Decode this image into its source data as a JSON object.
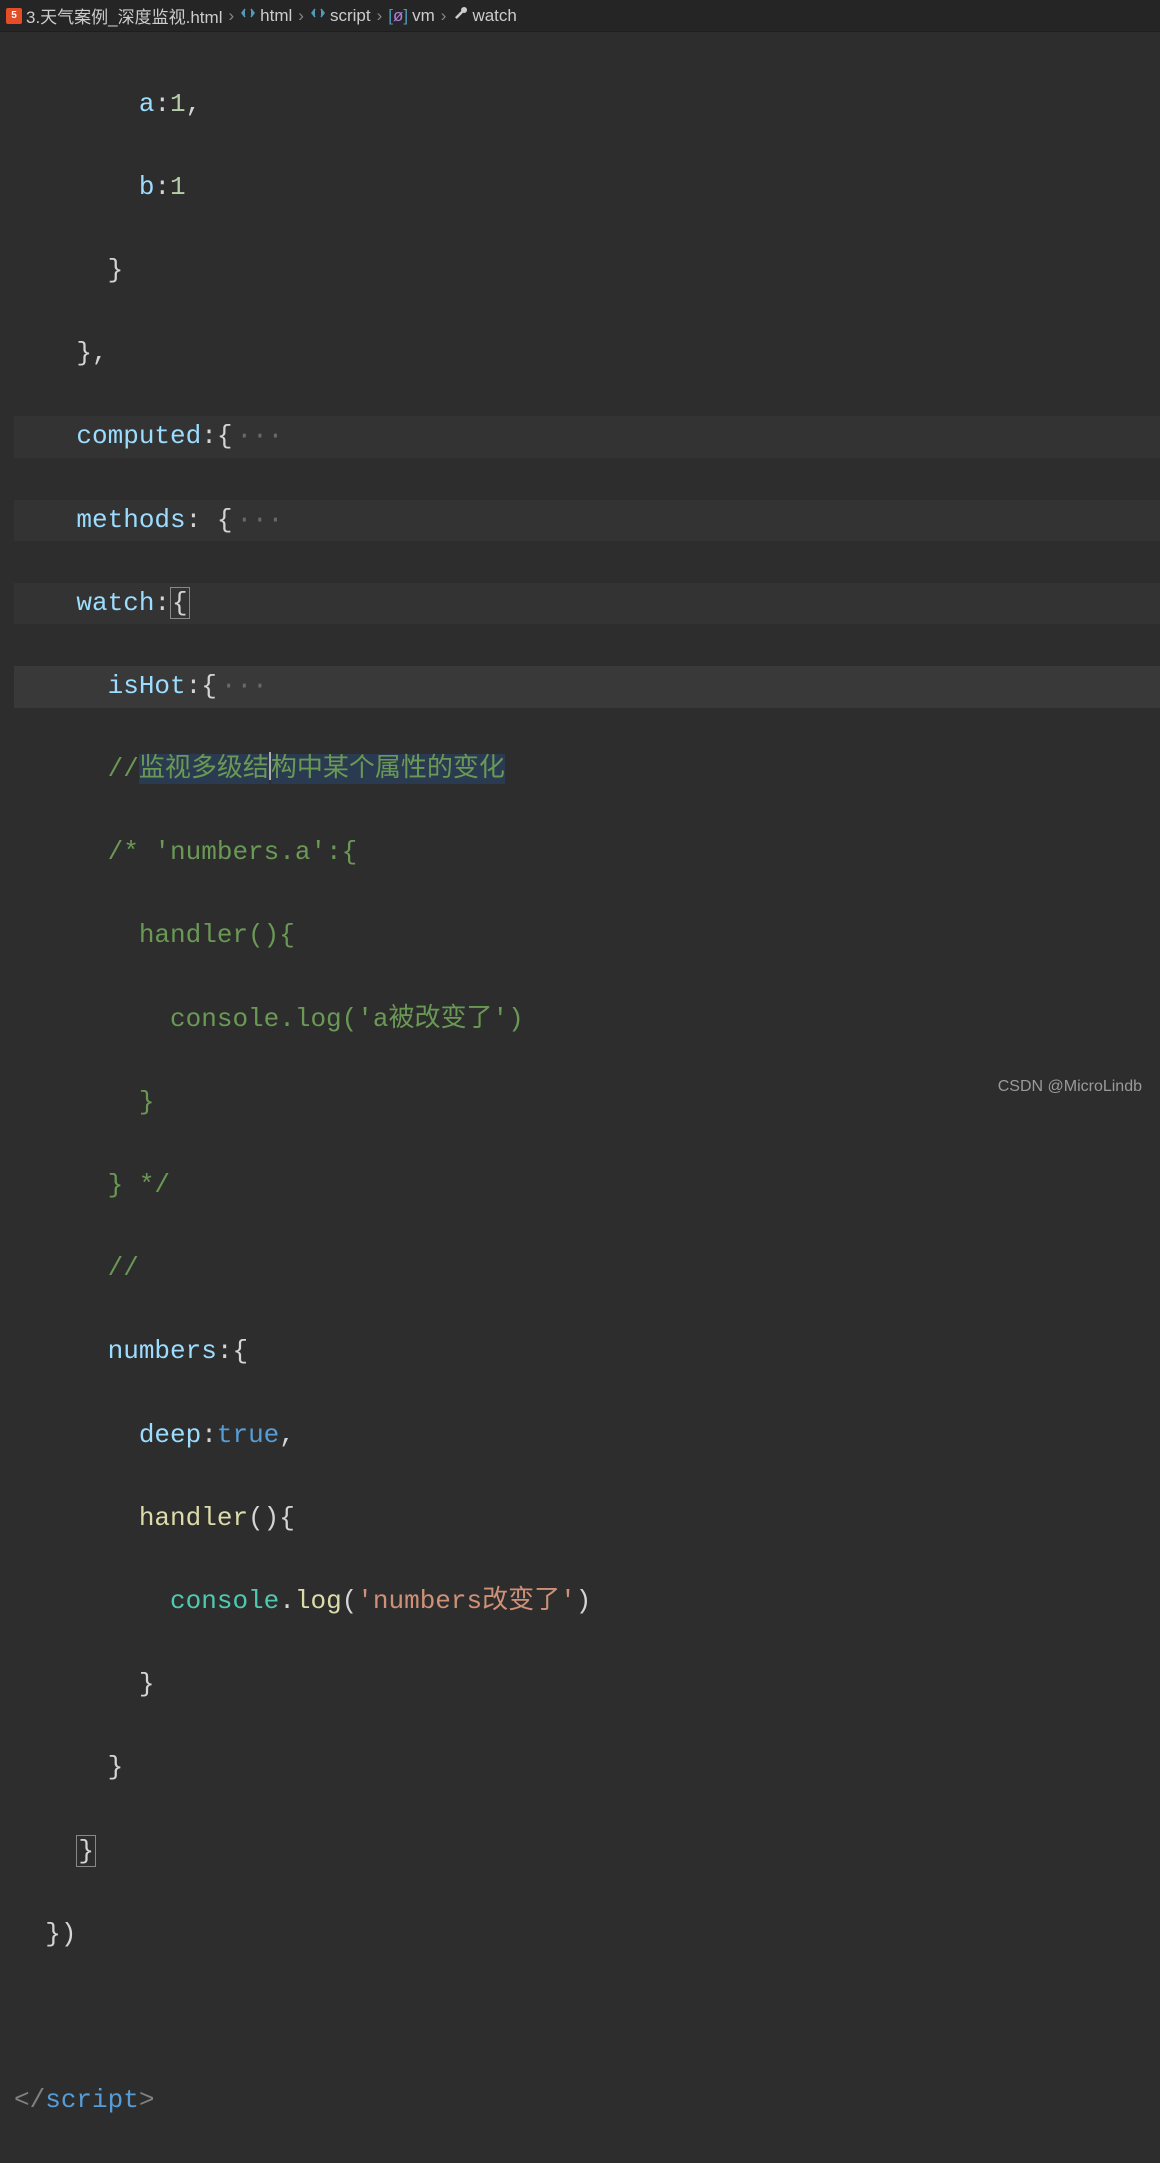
{
  "breadcrumb": {
    "file": "3.天气案例_深度监视.html",
    "path": [
      "html",
      "script",
      "vm",
      "watch"
    ]
  },
  "code": {
    "l1_ind": "        ",
    "l1_prop": "a",
    "l1_rest": ":",
    "l1_num": "1",
    "l1_end": ",",
    "l2_ind": "        ",
    "l2_prop": "b",
    "l2_rest": ":",
    "l2_num": "1",
    "l3_ind": "      ",
    "l3_txt": "}",
    "l4_ind": "    ",
    "l4_txt": "},",
    "l5_ind": "    ",
    "l5_prop": "computed",
    "l5_rest": ":{",
    "l5_fold": "···",
    "l6_ind": "    ",
    "l6_prop": "methods",
    "l6_rest": ": {",
    "l6_fold": "···",
    "l7_ind": "    ",
    "l7_prop": "watch",
    "l7_rest": ":",
    "l7_brace": "{",
    "l8_ind": "      ",
    "l8_prop": "isHot",
    "l8_rest": ":{",
    "l8_fold": "···",
    "l9_ind": "      ",
    "l9_c1": "//",
    "l9_c2": "监视多级结",
    "l9_c3": "构中某个属性的变化",
    "l10_ind": "      ",
    "l10_txt": "/* 'numbers.a':{",
    "l11_ind": "        ",
    "l11_txt": "handler(){",
    "l12_ind": "          ",
    "l12_txt": "console.log('a被改变了')",
    "l13_ind": "        ",
    "l13_txt": "}",
    "l14_ind": "      ",
    "l14_txt": "} */",
    "l15_ind": "      ",
    "l15_txt": "//",
    "l16_ind": "      ",
    "l16_prop": "numbers",
    "l16_rest": ":{",
    "l17_ind": "        ",
    "l17_prop": "deep",
    "l17_rest": ":",
    "l17_kw": "true",
    "l17_end": ",",
    "l18_ind": "        ",
    "l18_func": "handler",
    "l18_rest": "(){",
    "l19_ind": "          ",
    "l19_obj": "console",
    "l19_dot": ".",
    "l19_fn": "log",
    "l19_p1": "(",
    "l19_str": "'numbers改变了'",
    "l19_p2": ")",
    "l20_ind": "        ",
    "l20_txt": "}",
    "l21_ind": "      ",
    "l21_txt": "}",
    "l22_ind": "    ",
    "l22_brace": "}",
    "l23_ind": "  ",
    "l23_txt": "})",
    "l24_lead": "</",
    "l24_tag": "script",
    "l24_close": ">"
  },
  "watermark": "CSDN @MicroLindb"
}
